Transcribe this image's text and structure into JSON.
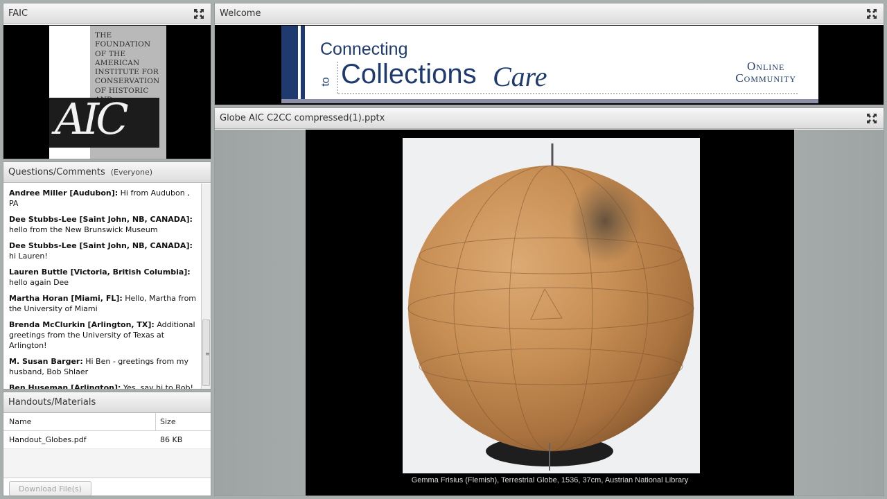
{
  "faic_pod": {
    "title": "FAIC",
    "logo_text": "THE FOUNDATION\nOF THE AMERICAN\nINSTITUTE FOR\nCONSERVATION\nOF HISTORIC AND\nARTISTIC WORKS",
    "logo_mark": "AIC"
  },
  "welcome_pod": {
    "title": "Welcome",
    "banner": {
      "connecting": "Connecting",
      "to": "to",
      "collections": "Collections",
      "care": "Care",
      "online_line1": "Online",
      "online_line2": "Community"
    }
  },
  "questions_pod": {
    "title": "Questions/Comments",
    "audience": "(Everyone)",
    "messages": [
      {
        "author": "Andree Miller [Audubon]:",
        "text": " Hi from Audubon , PA"
      },
      {
        "author": "Dee Stubbs-Lee [Saint John, NB, CANADA]:",
        "text": " hello from the New Brunswick Museum"
      },
      {
        "author": "Dee Stubbs-Lee [Saint John, NB, CANADA]:",
        "text": " hi Lauren!"
      },
      {
        "author": "Lauren Buttle [Victoria, British Columbia]:",
        "text": " hello again Dee"
      },
      {
        "author": "Martha Horan [Miami, FL]:",
        "text": " Hello, Martha from the University of Miami"
      },
      {
        "author": "Brenda McClurkin [Arlington, TX]:",
        "text": " Additional greetings from the University of Texas at Arlington!"
      },
      {
        "author": "M. Susan Barger:",
        "text": " Hi Ben - greetings from my husband, Bob Shlaer"
      },
      {
        "author": "Ben Huseman [Arlington]:",
        "text": " Yes, say hi to Bob!"
      }
    ]
  },
  "handouts_pod": {
    "title": "Handouts/Materials",
    "columns": {
      "name": "Name",
      "size": "Size"
    },
    "files": [
      {
        "name": "Handout_Globes.pdf",
        "size": "86 KB"
      }
    ],
    "download_label": "Download File(s)"
  },
  "share_pod": {
    "title": "Globe AIC C2CC compressed(1).pptx",
    "caption": "Gemma Frisius (Flemish), Terrestrial Globe, 1536,  37cm, Austrian National Library"
  },
  "icons": {
    "expand": "expand-icon"
  },
  "colors": {
    "brand_navy": "#1e3a6e",
    "panel_bg": "#a9aeae"
  }
}
